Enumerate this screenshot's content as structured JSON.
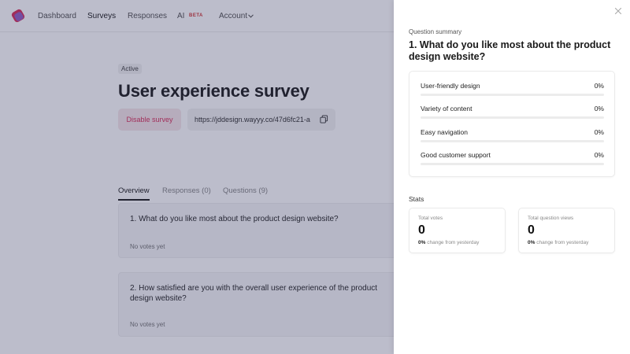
{
  "nav": {
    "items": [
      "Dashboard",
      "Surveys",
      "Responses",
      "AI",
      "Account"
    ],
    "beta_badge": "BETA"
  },
  "survey": {
    "status": "Active",
    "title": "User experience survey",
    "disable_label": "Disable survey",
    "url": "https://jddesign.wayyy.co/47d6fc21-a"
  },
  "tabs": [
    "Overview",
    "Responses (0)",
    "Questions (9)"
  ],
  "questions": [
    {
      "text": "1. What do you like most about the product design website?",
      "status": "No votes yet"
    },
    {
      "text": "2. How satisfied are you with the overall user experience of the product design website?",
      "status": "No votes yet"
    }
  ],
  "panel": {
    "summary_label": "Question summary",
    "question_title": "1. What do you like most about the product design website?",
    "options": [
      {
        "label": "User-friendly design",
        "percent_text": "0%",
        "fill": 0
      },
      {
        "label": "Variety of content",
        "percent_text": "0%",
        "fill": 0
      },
      {
        "label": "Easy navigation",
        "percent_text": "0%",
        "fill": 0
      },
      {
        "label": "Good customer support",
        "percent_text": "0%",
        "fill": 0
      }
    ],
    "stats_label": "Stats",
    "stats": [
      {
        "name": "Total votes",
        "value": "0",
        "change_value": "0%",
        "change_text": "change from yesterday"
      },
      {
        "name": "Total question views",
        "value": "0",
        "change_value": "0%",
        "change_text": "change from yesterday"
      }
    ]
  },
  "colors": {
    "accent": "#d9335d",
    "overlay": "#222454"
  },
  "icons": {
    "logo": "logo-icon",
    "account_chevron": "chevron-down-icon",
    "copy": "copy-icon",
    "close": "close-icon"
  }
}
